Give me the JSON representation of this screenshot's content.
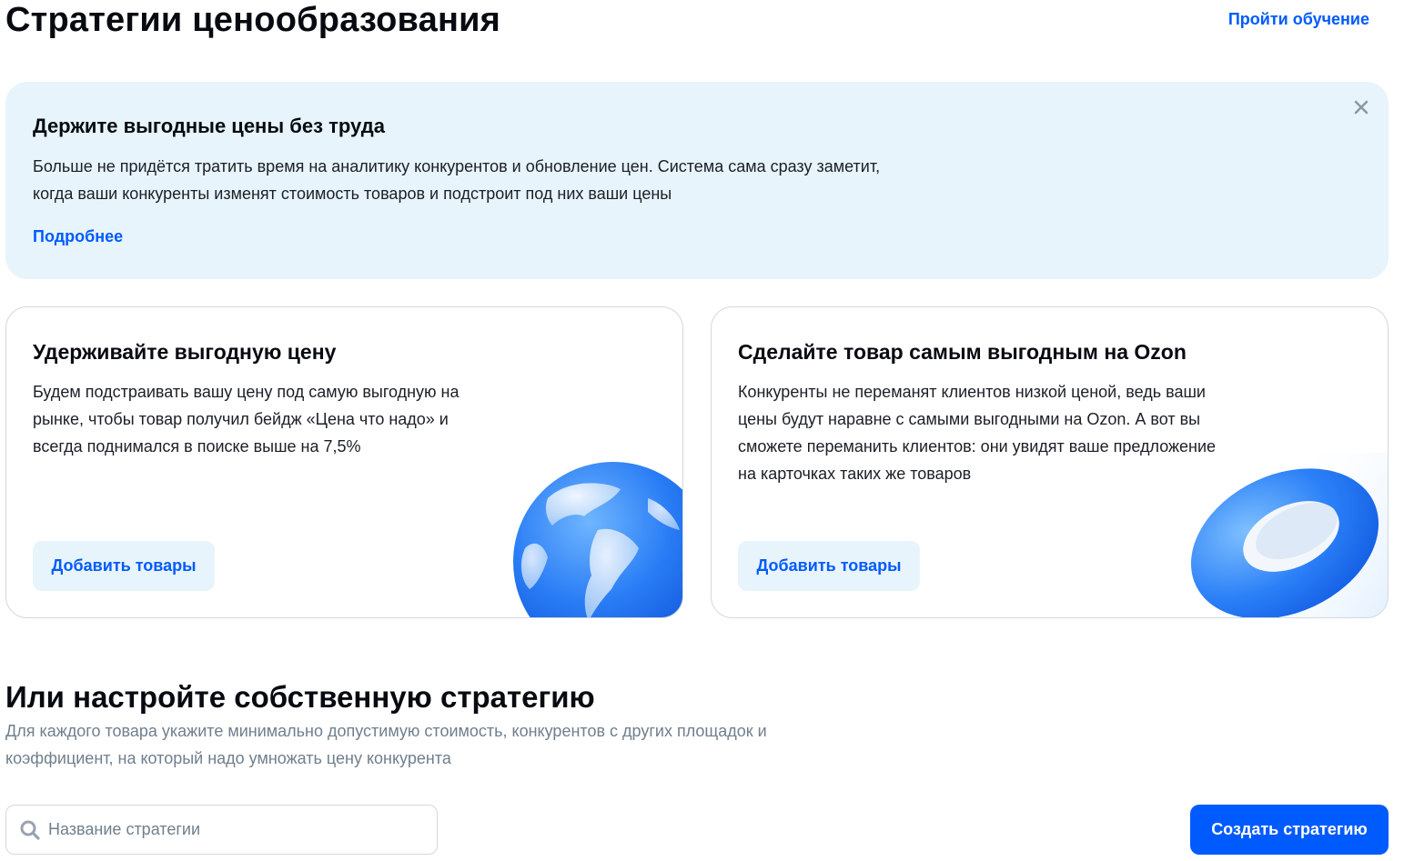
{
  "header": {
    "title": "Стратегии ценообразования",
    "training_link": "Пройти обучение"
  },
  "banner": {
    "title": "Держите выгодные цены без труда",
    "text": "Больше не придётся тратить время на аналитику конкурентов и обновление цен. Система сама сразу заметит, когда ваши конкуренты изменят стоимость товаров и подстроит под них ваши цены",
    "link": "Подробнее",
    "close_icon": "close-icon"
  },
  "cards": [
    {
      "title": "Удерживайте выгодную цену",
      "text": "Будем подстраивать вашу цену под самую выгодную на рынке, чтобы товар получил бейдж «Цена что надо» и всегда поднимался в поиске выше на 7,5%",
      "button": "Добавить товары",
      "illustration": "globe-illustration"
    },
    {
      "title": "Сделайте товар самым выгодным на Ozon",
      "text": "Конкуренты не переманят клиентов низкой ценой, ведь ваши цены будут наравне с самыми выгодными на Ozon. А вот вы сможете переманить клиентов: они увидят ваше предложение на карточках таких же товаров",
      "button": "Добавить товары",
      "illustration": "ring-illustration"
    }
  ],
  "custom": {
    "title": "Или настройте собственную стратегию",
    "text": "Для каждого товара укажите минимально допустимую стоимость, конкурентов с других площадок и коэффициент, на который надо умножать цену конкурента"
  },
  "search": {
    "placeholder": "Название стратегии",
    "value": ""
  },
  "create_button": "Создать стратегию",
  "colors": {
    "accent": "#005bff",
    "banner_bg": "#e8f4fc",
    "muted_text": "#707f8d"
  }
}
